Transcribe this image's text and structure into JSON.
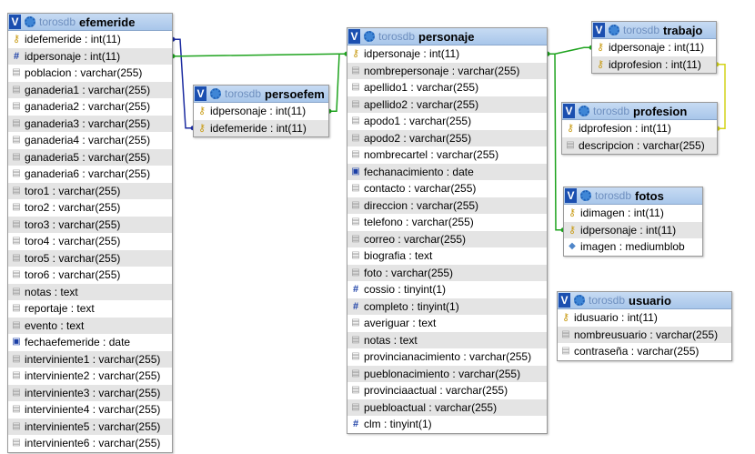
{
  "tables": [
    {
      "id": "efemeride",
      "db": "torosdb",
      "name": "efemeride",
      "columns": [
        {
          "icon": "key-icon",
          "text": "idefemeride : int(11)"
        },
        {
          "icon": "hash-icon",
          "text": "idpersonaje : int(11)"
        },
        {
          "icon": "field-icon",
          "text": "poblacion : varchar(255)"
        },
        {
          "icon": "field-icon",
          "text": "ganaderia1 : varchar(255)"
        },
        {
          "icon": "field-icon",
          "text": "ganaderia2 : varchar(255)"
        },
        {
          "icon": "field-icon",
          "text": "ganaderia3 : varchar(255)"
        },
        {
          "icon": "field-icon",
          "text": "ganaderia4 : varchar(255)"
        },
        {
          "icon": "field-icon",
          "text": "ganaderia5 : varchar(255)"
        },
        {
          "icon": "field-icon",
          "text": "ganaderia6 : varchar(255)"
        },
        {
          "icon": "field-icon",
          "text": "toro1 : varchar(255)"
        },
        {
          "icon": "field-icon",
          "text": "toro2 : varchar(255)"
        },
        {
          "icon": "field-icon",
          "text": "toro3 : varchar(255)"
        },
        {
          "icon": "field-icon",
          "text": "toro4 : varchar(255)"
        },
        {
          "icon": "field-icon",
          "text": "toro5 : varchar(255)"
        },
        {
          "icon": "field-icon",
          "text": "toro6 : varchar(255)"
        },
        {
          "icon": "field-icon",
          "text": "notas : text"
        },
        {
          "icon": "field-icon",
          "text": "reportaje : text"
        },
        {
          "icon": "field-icon",
          "text": "evento : text"
        },
        {
          "icon": "date-icon",
          "text": "fechaefemeride : date"
        },
        {
          "icon": "field-icon",
          "text": "interviniente1 : varchar(255)"
        },
        {
          "icon": "field-icon",
          "text": "interviniente2 : varchar(255)"
        },
        {
          "icon": "field-icon",
          "text": "interviniente3 : varchar(255)"
        },
        {
          "icon": "field-icon",
          "text": "interviniente4 : varchar(255)"
        },
        {
          "icon": "field-icon",
          "text": "interviniente5 : varchar(255)"
        },
        {
          "icon": "field-icon",
          "text": "interviniente6 : varchar(255)"
        }
      ]
    },
    {
      "id": "persoefem",
      "db": "torosdb",
      "name": "persoefem",
      "columns": [
        {
          "icon": "key-icon",
          "text": "idpersonaje : int(11)"
        },
        {
          "icon": "key-icon",
          "text": "idefemeride : int(11)"
        }
      ]
    },
    {
      "id": "personaje",
      "db": "torosdb",
      "name": "personaje",
      "columns": [
        {
          "icon": "key-icon",
          "text": "idpersonaje : int(11)"
        },
        {
          "icon": "field-icon",
          "text": "nombrepersonaje : varchar(255)"
        },
        {
          "icon": "field-icon",
          "text": "apellido1 : varchar(255)"
        },
        {
          "icon": "field-icon",
          "text": "apellido2 : varchar(255)"
        },
        {
          "icon": "field-icon",
          "text": "apodo1 : varchar(255)"
        },
        {
          "icon": "field-icon",
          "text": "apodo2 : varchar(255)"
        },
        {
          "icon": "field-icon",
          "text": "nombrecartel : varchar(255)"
        },
        {
          "icon": "date-icon",
          "text": "fechanacimiento : date"
        },
        {
          "icon": "field-icon",
          "text": "contacto : varchar(255)"
        },
        {
          "icon": "field-icon",
          "text": "direccion : varchar(255)"
        },
        {
          "icon": "field-icon",
          "text": "telefono : varchar(255)"
        },
        {
          "icon": "field-icon",
          "text": "correo : varchar(255)"
        },
        {
          "icon": "field-icon",
          "text": "biografia : text"
        },
        {
          "icon": "field-icon",
          "text": "foto : varchar(255)"
        },
        {
          "icon": "hash-icon",
          "text": "cossio : tinyint(1)"
        },
        {
          "icon": "hash-icon",
          "text": "completo : tinyint(1)"
        },
        {
          "icon": "field-icon",
          "text": "averiguar : text"
        },
        {
          "icon": "field-icon",
          "text": "notas : text"
        },
        {
          "icon": "field-icon",
          "text": "provincianacimiento : varchar(255)"
        },
        {
          "icon": "field-icon",
          "text": "pueblonacimiento : varchar(255)"
        },
        {
          "icon": "field-icon",
          "text": "provinciaactual : varchar(255)"
        },
        {
          "icon": "field-icon",
          "text": "puebloactual : varchar(255)"
        },
        {
          "icon": "hash-icon",
          "text": "clm : tinyint(1)"
        }
      ]
    },
    {
      "id": "trabajo",
      "db": "torosdb",
      "name": "trabajo",
      "columns": [
        {
          "icon": "key-icon",
          "text": "idpersonaje : int(11)"
        },
        {
          "icon": "key-icon",
          "text": "idprofesion : int(11)"
        }
      ]
    },
    {
      "id": "profesion",
      "db": "torosdb",
      "name": "profesion",
      "columns": [
        {
          "icon": "key-icon",
          "text": "idprofesion : int(11)"
        },
        {
          "icon": "field-icon",
          "text": "descripcion : varchar(255)"
        }
      ]
    },
    {
      "id": "fotos",
      "db": "torosdb",
      "name": "fotos",
      "columns": [
        {
          "icon": "key-icon",
          "text": "idimagen : int(11)"
        },
        {
          "icon": "key-icon",
          "text": "idpersonaje : int(11)"
        },
        {
          "icon": "blob-icon",
          "text": "imagen : mediumblob"
        }
      ]
    },
    {
      "id": "usuario",
      "db": "torosdb",
      "name": "usuario",
      "columns": [
        {
          "icon": "key-icon",
          "text": "idusuario : int(11)"
        },
        {
          "icon": "field-icon",
          "text": "nombreusuario : varchar(255)"
        },
        {
          "icon": "field-icon",
          "text": "contraseña : varchar(255)"
        }
      ]
    }
  ],
  "relations": [
    {
      "from": "efemeride",
      "from_col": 0,
      "to": "persoefem",
      "to_col": 1,
      "color": "#1b2ba0"
    },
    {
      "from": "personaje",
      "from_col": 0,
      "to": "persoefem",
      "to_col": 0,
      "color": "#1ea31e"
    },
    {
      "from": "personaje",
      "from_col": 0,
      "to": "efemeride",
      "to_col": 1,
      "color": "#1ea31e"
    },
    {
      "from": "personaje",
      "from_col": 0,
      "to": "trabajo",
      "to_col": 0,
      "color": "#1ea31e"
    },
    {
      "from": "personaje",
      "from_col": 0,
      "to": "fotos",
      "to_col": 1,
      "color": "#1ea31e"
    },
    {
      "from": "profesion",
      "from_col": 0,
      "to": "trabajo",
      "to_col": 1,
      "color": "#d4d41a"
    }
  ],
  "colors": {
    "header": "#b6cff0",
    "row_alt": "#e4e4e4",
    "border": "#9a9a9a"
  }
}
